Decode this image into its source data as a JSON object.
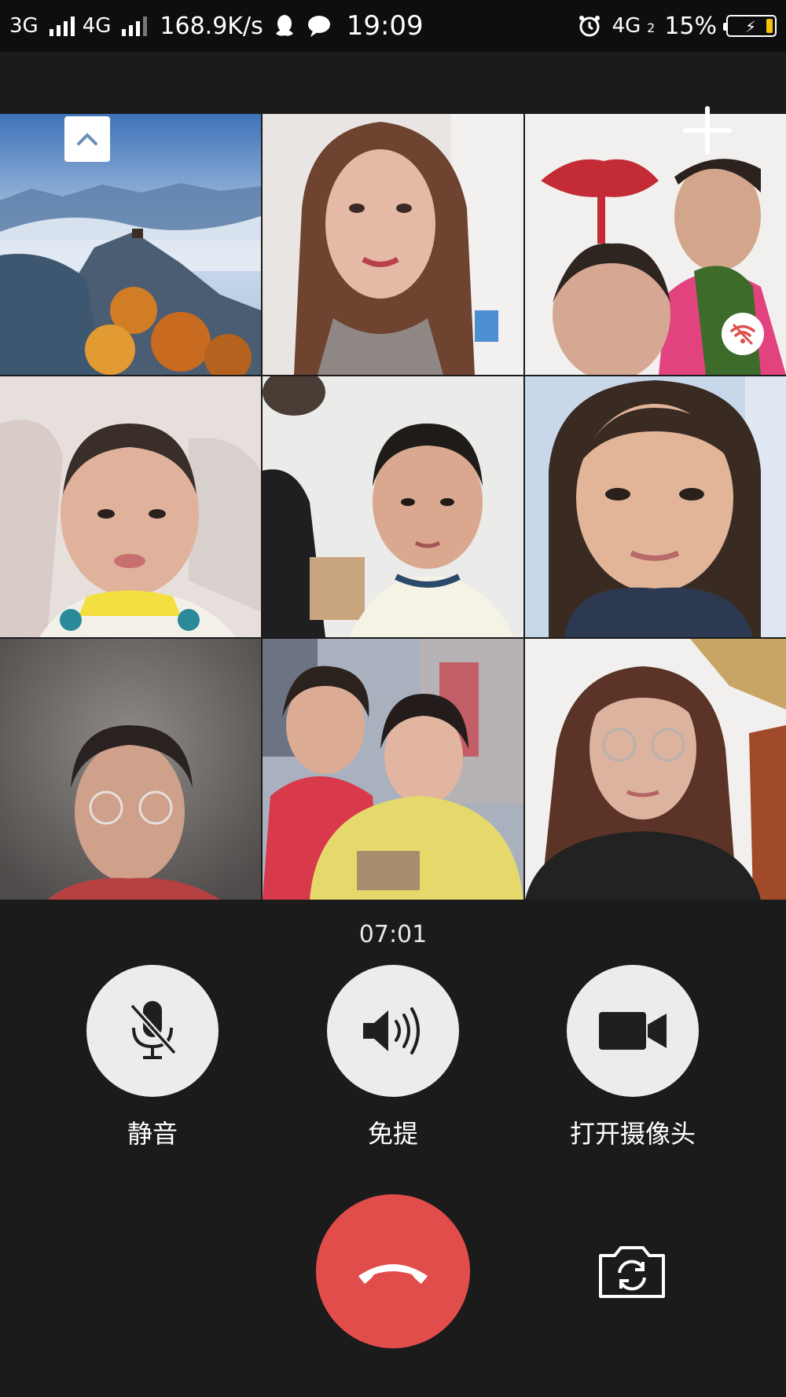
{
  "status_bar": {
    "net1": "3G",
    "net2": "4G",
    "speed": "168.9K/s",
    "time": "19:09",
    "net3": "4G",
    "net3_sub": "2",
    "battery": "15%",
    "icons": [
      "signal-icon",
      "qq-icon",
      "message-icon",
      "alarm-icon",
      "battery-icon"
    ]
  },
  "grid": {
    "tiles": [
      {
        "name": "mountain-scenery-tile",
        "colors": [
          "#6f8db8",
          "#c9d6e6",
          "#4b5f7a",
          "#d2842b"
        ]
      },
      {
        "name": "participant-woman-long-hair",
        "colors": [
          "#e8e4e2",
          "#7a4a33",
          "#e0b5a2"
        ]
      },
      {
        "name": "participant-family-home",
        "colors": [
          "#f1efee",
          "#c22d35",
          "#3f6d2d"
        ]
      },
      {
        "name": "participant-child-sofa",
        "colors": [
          "#e8e1df",
          "#d9a98f",
          "#2a8a9a"
        ]
      },
      {
        "name": "participant-boy-white-wall",
        "colors": [
          "#ececea",
          "#d6a68d",
          "#1e1e1e"
        ]
      },
      {
        "name": "participant-young-woman-scarf",
        "colors": [
          "#c9d7e8",
          "#e2b79b",
          "#2f3a4f"
        ]
      },
      {
        "name": "participant-man-glasses",
        "colors": [
          "#6d6a69",
          "#c99c86",
          "#b34141"
        ]
      },
      {
        "name": "participant-mother-daughter",
        "colors": [
          "#9ea6b6",
          "#d73a4a",
          "#e7dc6a"
        ]
      },
      {
        "name": "participant-woman-glasses",
        "colors": [
          "#f2f0ee",
          "#d9b39f",
          "#222222"
        ]
      }
    ]
  },
  "call": {
    "timer": "07:01",
    "mute_label": "静音",
    "speaker_label": "免提",
    "camera_label": "打开摄像头"
  },
  "colors": {
    "background": "#1b1b1b",
    "hangup": "#e14d4a",
    "control_circle": "#ececec"
  }
}
